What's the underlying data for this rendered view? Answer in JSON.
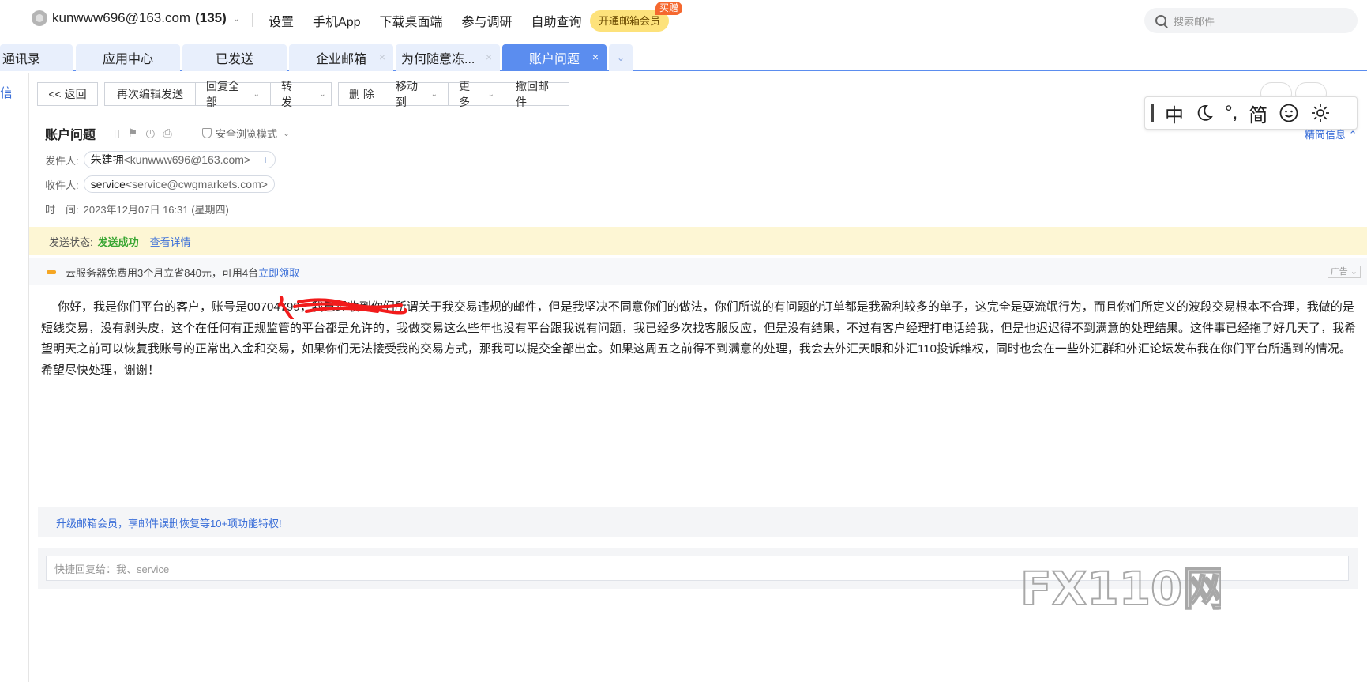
{
  "topbar": {
    "account_email": "kunwww696@163.com",
    "unread_count": "(135)",
    "links": [
      "设置",
      "手机App",
      "下载桌面端",
      "参与调研",
      "自助查询"
    ],
    "vip_button": "开通邮箱会员",
    "vip_badge": "买赠",
    "search_placeholder": "搜索邮件"
  },
  "tabs": [
    {
      "label": "通讯录"
    },
    {
      "label": "应用中心"
    },
    {
      "label": "已发送"
    },
    {
      "label": "企业邮箱"
    },
    {
      "label": "为何随意冻..."
    },
    {
      "label": "账户问题"
    }
  ],
  "tab_close_glyph": "×",
  "left_label": "信",
  "toolbar": {
    "back": "<< 返回",
    "re_edit": "再次编辑发送",
    "reply_all": "回复全部",
    "forward": "转 发",
    "delete": "删 除",
    "move_to": "移动到",
    "more": "更 多",
    "recall": "撤回邮件"
  },
  "ime": {
    "mode": "中",
    "punct": "°,",
    "script": "简"
  },
  "message": {
    "subject": "账户问题",
    "secure_mode": "安全浏览模式",
    "detail_link": "精简信息",
    "from_label": "发件人:",
    "from_name": "朱建拥",
    "from_addr": "<kunwww696@163.com>",
    "to_label": "收件人:",
    "to_name": "service",
    "to_addr": "<service@cwgmarkets.com>",
    "time_label": "时　间:",
    "time_value": "2023年12月07日 16:31 (星期四)",
    "body": "你好，我是你们平台的客户，账号是00704799，我已经收到你们所谓关于我交易违规的邮件，但是我坚决不同意你们的做法，你们所说的有问题的订单都是我盈利较多的单子，这完全是耍流氓行为，而且你们所定义的波段交易根本不合理，我做的是短线交易，没有剥头皮，这个在任何有正规监管的平台都是允许的，我做交易这么些年也没有平台跟我说有问题，我已经多次找客服反应，但是没有结果，不过有客户经理打电话给我，但是也迟迟得不到满意的处理结果。这件事已经拖了好几天了，我希望明天之前可以恢复我账号的正常出入金和交易，如果你们无法接受我的交易方式，那我可以提交全部出金。如果这周五之前得不到满意的处理，我会去外汇天眼和外汇110投诉维权，同时也会在一些外汇群和外汇论坛发布我在你们平台所遇到的情况。希望尽快处理，谢谢！"
  },
  "status": {
    "label": "发送状态:",
    "value": "发送成功",
    "link": "查看详情"
  },
  "ad": {
    "text": "云服务器免费用3个月立省840元，可用4台",
    "link": "立即领取",
    "tag": "广告"
  },
  "upgrade_text": "升级邮箱会员，享邮件误删恢复等10+项功能特权!",
  "quick_reply_placeholder": "快捷回复给：我、service",
  "watermark_text": "FX110网",
  "colors": {
    "accent": "#5b8def",
    "link": "#3b6fd8",
    "success": "#3aa633",
    "vip": "#fde27b"
  }
}
